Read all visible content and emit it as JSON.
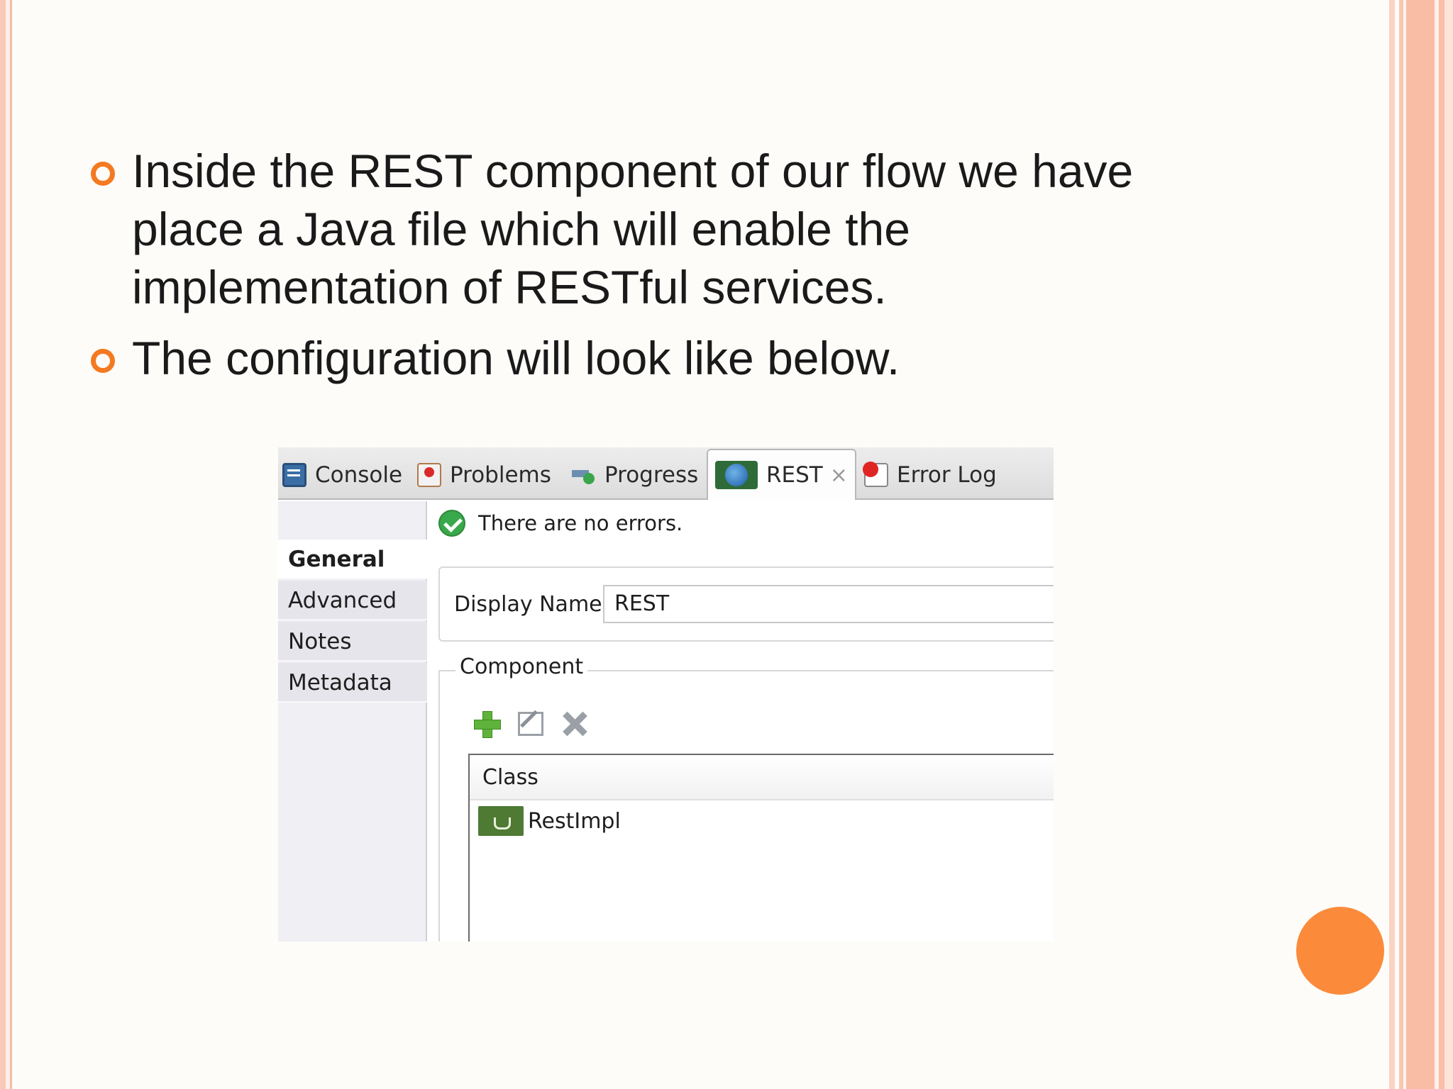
{
  "slide": {
    "bullets": [
      "Inside the REST component of our flow we have place a Java file which will enable the implementation of RESTful services.",
      "The configuration will look like below."
    ]
  },
  "tabs": [
    {
      "label": "Console",
      "icon": "console-icon"
    },
    {
      "label": "Problems",
      "icon": "problems-icon"
    },
    {
      "label": "Progress",
      "icon": "progress-icon"
    },
    {
      "label": "REST",
      "icon": "globe-icon",
      "active": true,
      "close": "×"
    },
    {
      "label": "Error Log",
      "icon": "error-log-icon"
    }
  ],
  "sidebar": {
    "items": [
      {
        "label": "General",
        "selected": true
      },
      {
        "label": "Advanced"
      },
      {
        "label": "Notes"
      },
      {
        "label": "Metadata"
      }
    ]
  },
  "panel": {
    "status": "There are no errors.",
    "display_name_label": "Display Name:",
    "display_name_value": "REST",
    "component_legend": "Component",
    "table_header": "Class",
    "rows": [
      "RestImpl"
    ]
  },
  "colors": {
    "accent": "#f47a22",
    "dot": "#fb8b3b"
  }
}
